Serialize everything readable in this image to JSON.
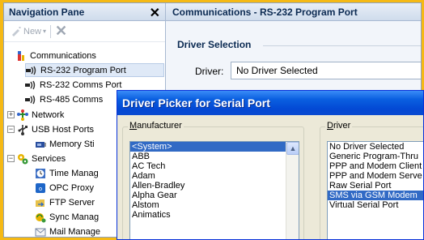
{
  "nav": {
    "title": "Navigation Pane",
    "close_glyph": "✕",
    "new_label": "New",
    "items": [
      {
        "label": "Communications",
        "icon": "communications-icon"
      },
      {
        "label": "RS-232 Program Port",
        "icon": "serial-port-icon",
        "selected": true
      },
      {
        "label": "RS-232 Comms Port",
        "icon": "serial-port-icon"
      },
      {
        "label": "RS-485 Comms",
        "icon": "serial-port-icon"
      },
      {
        "label": "Network",
        "icon": "network-icon"
      },
      {
        "label": "USB Host Ports",
        "icon": "usb-icon"
      },
      {
        "label": "Memory Sti",
        "icon": "memory-stick-icon"
      },
      {
        "label": "Services",
        "icon": "services-icon"
      },
      {
        "label": "Time Manag",
        "icon": "time-icon"
      },
      {
        "label": "OPC Proxy",
        "icon": "opc-icon"
      },
      {
        "label": "FTP Server",
        "icon": "ftp-icon"
      },
      {
        "label": "Sync Manag",
        "icon": "sync-icon"
      },
      {
        "label": "Mail Manage",
        "icon": "mail-icon"
      }
    ]
  },
  "content": {
    "title": "Communications - RS-232 Program Port",
    "section": "Driver Selection",
    "driver_label": "Driver:",
    "driver_value": "No Driver Selected"
  },
  "dialog": {
    "title": "Driver Picker for Serial Port",
    "manufacturer_label": "Manufacturer",
    "manufacturer_underline": "M",
    "manufacturer_rest": "anufacturer",
    "driver_label": "Driver",
    "driver_underline": "D",
    "driver_rest": "river",
    "manufacturers": [
      "<System>",
      "ABB",
      "AC Tech",
      "Adam",
      "Allen-Bradley",
      "Alpha Gear",
      "Alstom",
      "Animatics"
    ],
    "manufacturer_selected": 0,
    "drivers": [
      "No Driver Selected",
      "Generic Program-Thru",
      "PPP and Modem Client",
      "PPP and Modem Serve",
      "Raw Serial Port",
      "SMS via GSM Modem",
      "Virtual Serial Port"
    ],
    "driver_selected": 5
  },
  "colors": {
    "accent_border": "#f5b915",
    "selection": "#316ac5",
    "titlebar": "#0a5fe0"
  }
}
